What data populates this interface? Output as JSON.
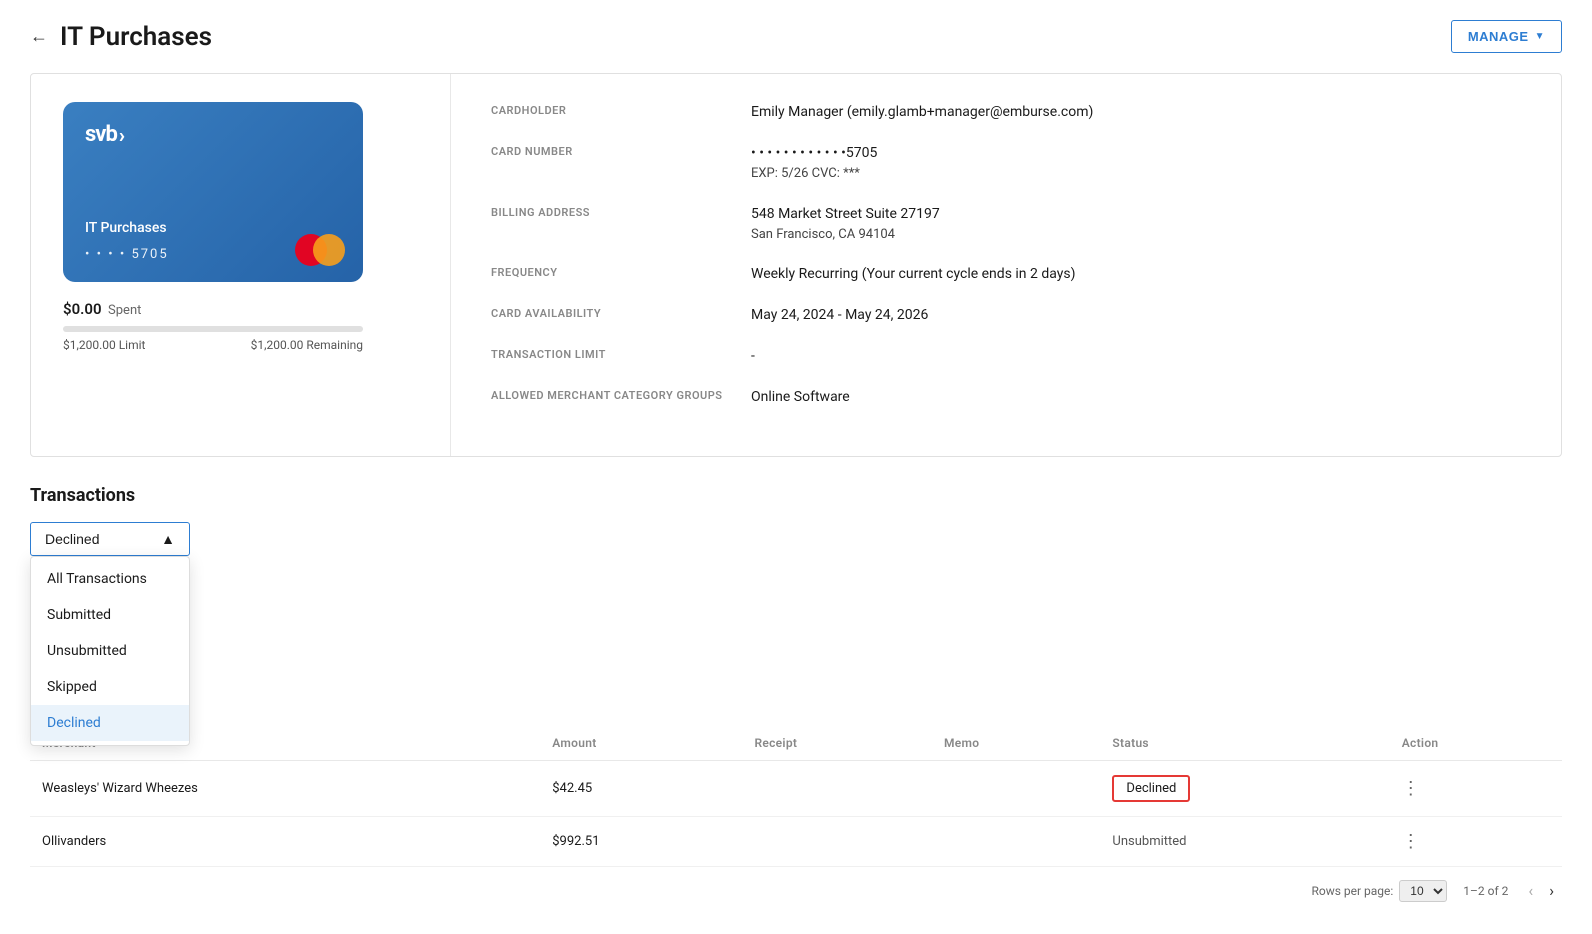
{
  "header": {
    "back_label": "←",
    "title": "IT Purchases",
    "manage_button": "MANAGE",
    "manage_chevron": "▼"
  },
  "card": {
    "bank_name": "svb",
    "bank_chevron": "›",
    "card_name": "IT Purchases",
    "card_number_display": "• • • •  5705",
    "mastercard_alt": "Mastercard logo",
    "spent_amount": "$0.00",
    "spent_label": "Spent",
    "progress_percent": 0,
    "limit_label": "$1,200.00 Limit",
    "remaining_label": "$1,200.00 Remaining"
  },
  "card_info": {
    "cardholder_label": "CARDHOLDER",
    "cardholder_value": "Emily Manager (emily.glamb+manager@emburse.com)",
    "card_number_label": "CARD NUMBER",
    "card_number_value": "• • • • • • • • • • • •5705",
    "card_expiry": "EXP: 5/26   CVC: ***",
    "billing_address_label": "BILLING ADDRESS",
    "billing_address_line1": "548 Market Street Suite 27197",
    "billing_address_line2": "San Francisco, CA 94104",
    "frequency_label": "FREQUENCY",
    "frequency_value": "Weekly Recurring (Your current cycle ends in 2 days)",
    "card_availability_label": "CARD AVAILABILITY",
    "card_availability_value": "May 24, 2024 - May 24, 2026",
    "transaction_limit_label": "TRANSACTION LIMIT",
    "transaction_limit_value": "-",
    "merchant_category_label": "ALLOWED MERCHANT CATEGORY GROUPS",
    "merchant_category_value": "Online Software"
  },
  "transactions": {
    "section_title": "Transactions",
    "filter_selected": "Declined",
    "filter_chevron": "▲",
    "dropdown_items": [
      {
        "label": "All Transactions",
        "active": false
      },
      {
        "label": "Submitted",
        "active": false
      },
      {
        "label": "Unsubmitted",
        "active": false
      },
      {
        "label": "Skipped",
        "active": false
      },
      {
        "label": "Declined",
        "active": true
      }
    ],
    "table_headers": [
      "Merchant",
      "Amount",
      "Receipt",
      "Memo",
      "Status",
      "Action"
    ],
    "rows": [
      {
        "merchant": "Weasleys' Wizard Wheezes",
        "amount": "$42.45",
        "receipt": "",
        "memo": "",
        "status": "Declined",
        "status_type": "declined",
        "action": "⋮"
      },
      {
        "merchant": "Ollivanders",
        "amount": "$992.51",
        "receipt": "",
        "memo": "",
        "status": "Unsubmitted",
        "status_type": "unsubmitted",
        "action": "⋮"
      }
    ],
    "footer": {
      "rows_per_page_label": "Rows per page:",
      "rows_per_page_value": "10",
      "rows_per_page_chevron": "▼",
      "pagination_info": "1–2 of 2",
      "prev_arrow": "‹",
      "next_arrow": "›"
    }
  }
}
